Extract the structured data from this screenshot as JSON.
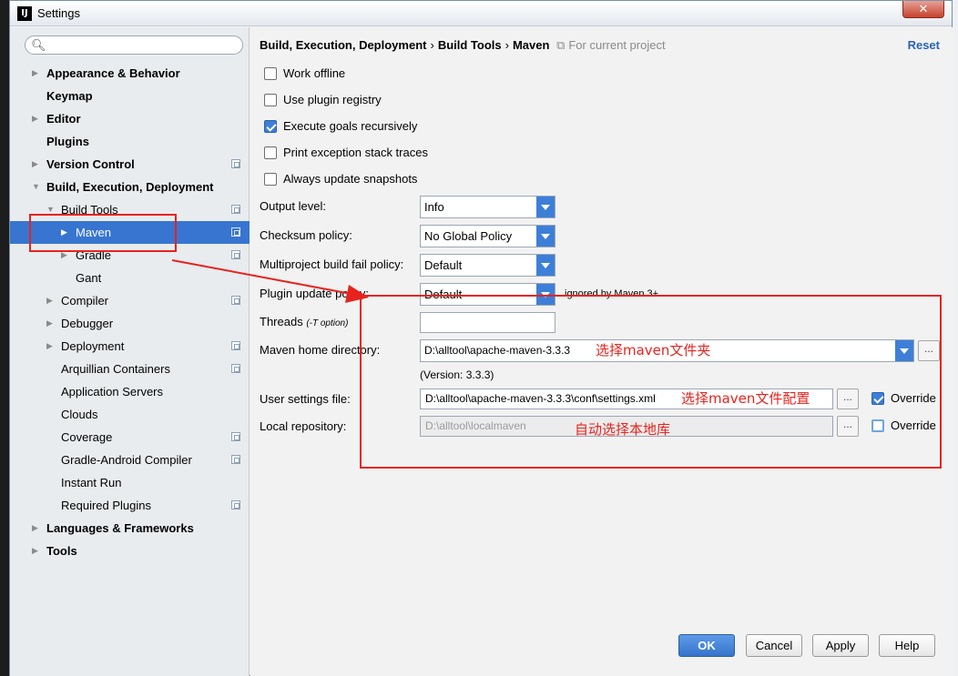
{
  "window": {
    "title": "Settings",
    "close_label": "✕"
  },
  "search": {
    "placeholder": ""
  },
  "tree": [
    {
      "label": "Appearance & Behavior",
      "bold": true,
      "indent": 0,
      "arrow": "right",
      "badge": false
    },
    {
      "label": "Keymap",
      "bold": true,
      "indent": 0,
      "arrow": "",
      "badge": false
    },
    {
      "label": "Editor",
      "bold": true,
      "indent": 0,
      "arrow": "right",
      "badge": false
    },
    {
      "label": "Plugins",
      "bold": true,
      "indent": 0,
      "arrow": "",
      "badge": false
    },
    {
      "label": "Version Control",
      "bold": true,
      "indent": 0,
      "arrow": "right",
      "badge": true
    },
    {
      "label": "Build, Execution, Deployment",
      "bold": true,
      "indent": 0,
      "arrow": "down",
      "badge": false
    },
    {
      "label": "Build Tools",
      "bold": false,
      "indent": 1,
      "arrow": "down",
      "badge": true
    },
    {
      "label": "Maven",
      "bold": false,
      "indent": 2,
      "arrow": "right",
      "badge": true,
      "selected": true
    },
    {
      "label": "Gradle",
      "bold": false,
      "indent": 2,
      "arrow": "right",
      "badge": true
    },
    {
      "label": "Gant",
      "bold": false,
      "indent": 2,
      "arrow": "",
      "badge": false
    },
    {
      "label": "Compiler",
      "bold": false,
      "indent": 1,
      "arrow": "right",
      "badge": true
    },
    {
      "label": "Debugger",
      "bold": false,
      "indent": 1,
      "arrow": "right",
      "badge": false
    },
    {
      "label": "Deployment",
      "bold": false,
      "indent": 1,
      "arrow": "right",
      "badge": true
    },
    {
      "label": "Arquillian Containers",
      "bold": false,
      "indent": 1,
      "arrow": "",
      "badge": true
    },
    {
      "label": "Application Servers",
      "bold": false,
      "indent": 1,
      "arrow": "",
      "badge": false
    },
    {
      "label": "Clouds",
      "bold": false,
      "indent": 1,
      "arrow": "",
      "badge": false
    },
    {
      "label": "Coverage",
      "bold": false,
      "indent": 1,
      "arrow": "",
      "badge": true
    },
    {
      "label": "Gradle-Android Compiler",
      "bold": false,
      "indent": 1,
      "arrow": "",
      "badge": true
    },
    {
      "label": "Instant Run",
      "bold": false,
      "indent": 1,
      "arrow": "",
      "badge": false
    },
    {
      "label": "Required Plugins",
      "bold": false,
      "indent": 1,
      "arrow": "",
      "badge": true
    },
    {
      "label": "Languages & Frameworks",
      "bold": true,
      "indent": 0,
      "arrow": "right",
      "badge": false
    },
    {
      "label": "Tools",
      "bold": true,
      "indent": 0,
      "arrow": "right",
      "badge": false
    }
  ],
  "breadcrumb": {
    "part1": "Build, Execution, Deployment",
    "sep": "›",
    "part2": "Build Tools",
    "part3": "Maven",
    "scope": "For current project"
  },
  "reset_label": "Reset",
  "checkboxes": [
    {
      "label": "Work offline",
      "checked": false
    },
    {
      "label": "Use plugin registry",
      "checked": false
    },
    {
      "label": "Execute goals recursively",
      "checked": true
    },
    {
      "label": "Print exception stack traces",
      "checked": false
    },
    {
      "label": "Always update snapshots",
      "checked": false
    }
  ],
  "fields": {
    "output_level": {
      "label": "Output level:",
      "value": "Info"
    },
    "checksum": {
      "label": "Checksum policy:",
      "value": "No Global Policy"
    },
    "multiproject": {
      "label": "Multiproject build fail policy:",
      "value": "Default"
    },
    "plugin_update": {
      "label": "Plugin update policy:",
      "value": "Default",
      "hint": "ignored by Maven 3+"
    },
    "threads": {
      "label": "Threads",
      "hint": "(-T option)",
      "value": ""
    },
    "maven_home": {
      "label": "Maven home directory:",
      "value": "D:\\alltool\\apache-maven-3.3.3",
      "version": "(Version: 3.3.3)"
    },
    "user_settings": {
      "label": "User settings file:",
      "value": "D:\\alltool\\apache-maven-3.3.3\\conf\\settings.xml",
      "override_label": "Override",
      "override": true
    },
    "local_repo": {
      "label": "Local repository:",
      "value": "D:\\alltool\\localmaven",
      "override_label": "Override",
      "override": false
    }
  },
  "annotations": {
    "maven_home": "选择maven文件夹",
    "settings": "选择maven文件配置",
    "local_repo": "自动选择本地库"
  },
  "buttons": {
    "ok": "OK",
    "cancel": "Cancel",
    "apply": "Apply",
    "help": "Help",
    "dots": "..."
  },
  "colors": {
    "selection": "#3775d0",
    "accent": "#3d7fd8",
    "annotation": "#e8231e",
    "link": "#2a63b0"
  }
}
